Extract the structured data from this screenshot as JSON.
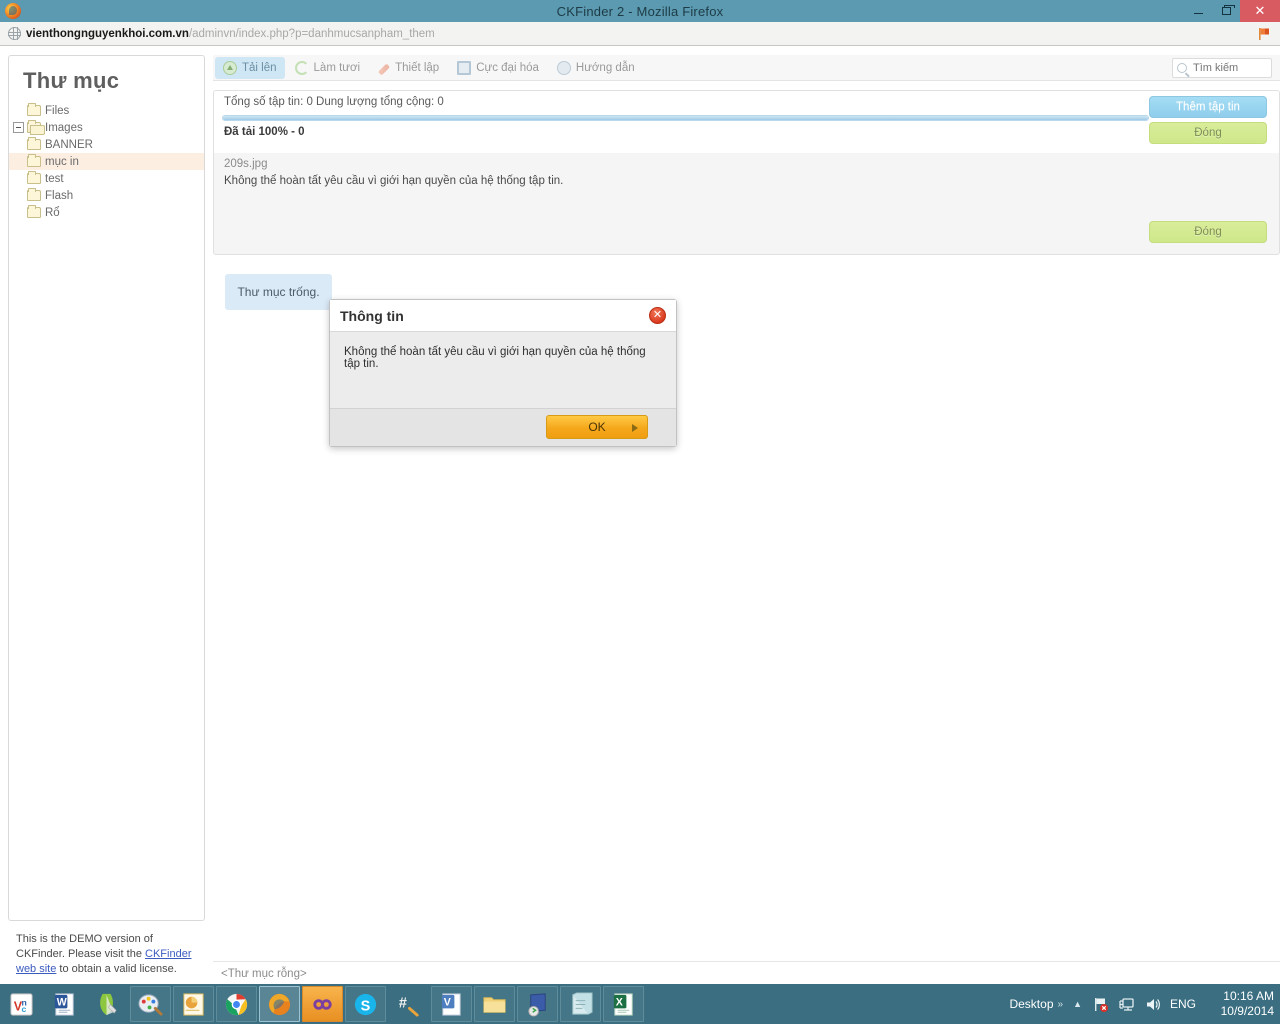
{
  "window": {
    "title": "CKFinder 2 - Mozilla Firefox",
    "minimize_label": "Minimize",
    "restore_label": "Restore",
    "close_label": "✕"
  },
  "browser": {
    "url_host": "vienthongnguyenkhoi.com.vn",
    "url_path": "/adminvn/index.php?p=danhmucsanpham_them",
    "flag_icon": "flag-icon",
    "globe_icon": "globe-icon"
  },
  "folders": {
    "title": "Thư mục",
    "items": [
      {
        "label": "Files",
        "level": 0,
        "expandable": false,
        "open": false,
        "selected": false
      },
      {
        "label": "Images",
        "level": 0,
        "expandable": true,
        "open": true,
        "selected": false
      },
      {
        "label": "BANNER",
        "level": 1,
        "expandable": false,
        "open": false,
        "selected": false
      },
      {
        "label": "mục in",
        "level": 1,
        "expandable": false,
        "open": false,
        "selected": true
      },
      {
        "label": "test",
        "level": 1,
        "expandable": false,
        "open": false,
        "selected": false
      },
      {
        "label": "Flash",
        "level": 0,
        "expandable": false,
        "open": false,
        "selected": false
      },
      {
        "label": "Rổ",
        "level": 0,
        "expandable": false,
        "open": false,
        "selected": false
      }
    ]
  },
  "demo": {
    "line1": "This is the DEMO version of CKFinder.",
    "line2_pre": "Please visit the ",
    "link": "CKFinder web site",
    "line2_post": " to",
    "line3": "obtain a valid license."
  },
  "toolbar": {
    "items": [
      {
        "label": "Tải lên",
        "icon": "upload-icon",
        "active": true
      },
      {
        "label": "Làm tươi",
        "icon": "refresh-icon",
        "active": false
      },
      {
        "label": "Thiết lập",
        "icon": "settings-icon",
        "active": false
      },
      {
        "label": "Cực đại hóa",
        "icon": "maximize-icon",
        "active": false
      },
      {
        "label": "Hướng dẫn",
        "icon": "help-icon",
        "active": false
      }
    ],
    "search_placeholder": "Tìm kiếm",
    "search_value": ""
  },
  "upload": {
    "stats": "Tổng số tập tin: 0 Dung lượng tổng cộng: 0",
    "progress_percent": 100,
    "status": "Đã tải 100% - 0",
    "file_name": "209s.jpg",
    "file_error": "Không thể hoàn tất yêu cầu vì giới hạn quyền của hệ thống tập tin.",
    "add_files_label": "Thêm tập tin",
    "close_label_1": "Đóng",
    "close_label_2": "Đóng"
  },
  "content": {
    "empty_notice": "Thư mục trống.",
    "statusbar": "<Thư mục rỗng>"
  },
  "dialog": {
    "title": "Thông tin",
    "message": "Không thể hoàn tất yêu cầu vì giới hạn quyền của hệ thống tập tin.",
    "ok_label": "OK",
    "close_icon": "✕"
  },
  "taskbar": {
    "apps": [
      {
        "name": "vnc-viewer",
        "label": "VNC",
        "state": "plain"
      },
      {
        "name": "microsoft-word",
        "label": "W",
        "state": "plain"
      },
      {
        "name": "notepad-pencil",
        "label": "",
        "state": "plain"
      },
      {
        "name": "paint",
        "label": "",
        "state": "framed"
      },
      {
        "name": "powerpoint-viewer",
        "label": "",
        "state": "framed"
      },
      {
        "name": "google-chrome",
        "label": "",
        "state": "framed"
      },
      {
        "name": "mozilla-firefox",
        "label": "",
        "state": "active"
      },
      {
        "name": "infinity-app",
        "label": "∞",
        "state": "hot"
      },
      {
        "name": "skype",
        "label": "S",
        "state": "framed"
      },
      {
        "name": "hash-tool",
        "label": "#",
        "state": "plain"
      },
      {
        "name": "microsoft-visio",
        "label": "V",
        "state": "framed"
      },
      {
        "name": "file-explorer",
        "label": "",
        "state": "framed"
      },
      {
        "name": "remote-desktop",
        "label": "",
        "state": "framed"
      },
      {
        "name": "notepad",
        "label": "",
        "state": "framed"
      },
      {
        "name": "microsoft-excel",
        "label": "X",
        "state": "framed"
      }
    ],
    "desktop_label": "Desktop",
    "overflow_chevron": "»",
    "show_hidden": "▲",
    "tray_icons": [
      "network-error-icon",
      "display-icon",
      "volume-icon"
    ],
    "language": "ENG",
    "time": "10:16 AM",
    "date": "10/9/2014"
  },
  "colors": {
    "titlebar": "#5b9ab0",
    "taskbar": "#3a6e80",
    "accent_blue": "#9ecbe6",
    "accent_green": "#cfe88a",
    "accent_orange": "#f5a81c",
    "selection": "#fdeee2",
    "info_box": "#dbeaf7"
  }
}
